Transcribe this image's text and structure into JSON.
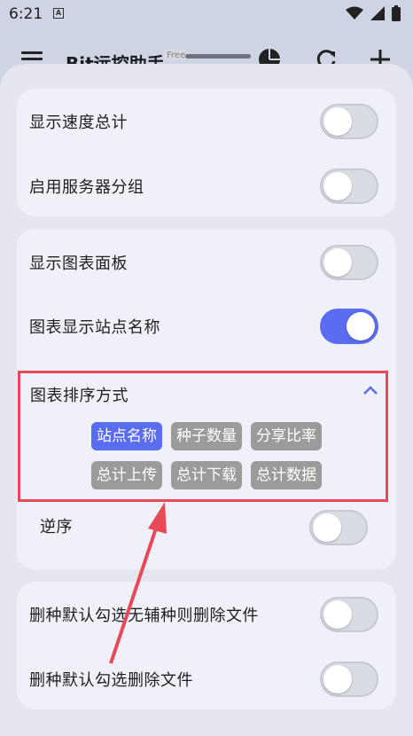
{
  "status_bar": {
    "time": "6:21",
    "notification_letter": "A"
  },
  "app_bar": {
    "title": "Bit远控助手",
    "badge": "Free"
  },
  "settings": {
    "card1": [
      {
        "label": "显示速度总计",
        "on": false
      },
      {
        "label": "启用服务器分组",
        "on": false
      }
    ],
    "card2": [
      {
        "label": "显示图表面板",
        "on": false
      },
      {
        "label": "图表显示站点名称",
        "on": true
      }
    ],
    "sort": {
      "title": "图表排序方式",
      "options": [
        "站点名称",
        "种子数量",
        "分享比率",
        "总计上传",
        "总计下载",
        "总计数据"
      ],
      "selected": "站点名称"
    },
    "reverse": {
      "label": "逆序",
      "on": false
    },
    "card3": [
      {
        "label": "删种默认勾选无辅种则删除文件",
        "on": false
      },
      {
        "label": "删种默认勾选删除文件",
        "on": false
      }
    ]
  },
  "colors": {
    "accent": "#5a6cf0",
    "highlight": "#e64a57",
    "chip_inactive": "#9b9b9b"
  }
}
